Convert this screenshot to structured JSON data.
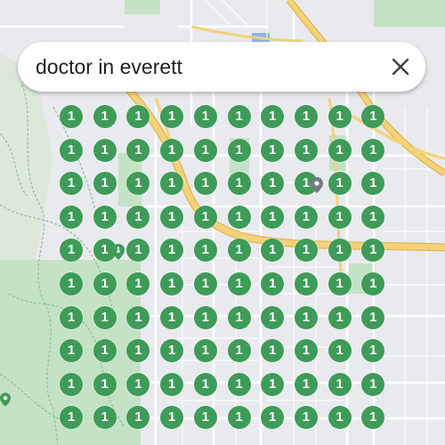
{
  "search": {
    "query": "doctor in everett",
    "close_icon": "close-icon"
  },
  "map": {
    "colors": {
      "land": "#e9eaee",
      "park": "#c4e2c5",
      "park_dark": "#b7dbb9",
      "highway": "#f3d27a",
      "highway_edge": "#e3b54b",
      "road": "#ffffff",
      "trail": "#8cc291",
      "water_blue": "#8ab4f8",
      "poi_grey": "#737a83"
    }
  },
  "grid": {
    "rows": 10,
    "cols": 10,
    "marker_color": "#3e9b58",
    "text_color": "#ffffff",
    "ranks": [
      [
        "1",
        "1",
        "1",
        "1",
        "1",
        "1",
        "1",
        "1",
        "1",
        "1"
      ],
      [
        "1",
        "1",
        "1",
        "1",
        "1",
        "1",
        "1",
        "1",
        "1",
        "1"
      ],
      [
        "1",
        "1",
        "1",
        "1",
        "1",
        "1",
        "1",
        "1",
        "1",
        "1"
      ],
      [
        "1",
        "1",
        "1",
        "1",
        "1",
        "1",
        "1",
        "1",
        "1",
        "1"
      ],
      [
        "1",
        "1",
        "1",
        "1",
        "1",
        "1",
        "1",
        "1",
        "1",
        "1"
      ],
      [
        "1",
        "1",
        "1",
        "1",
        "1",
        "1",
        "1",
        "1",
        "1",
        "1"
      ],
      [
        "1",
        "1",
        "1",
        "1",
        "1",
        "1",
        "1",
        "1",
        "1",
        "1"
      ],
      [
        "1",
        "1",
        "1",
        "1",
        "1",
        "1",
        "1",
        "1",
        "1",
        "1"
      ],
      [
        "1",
        "1",
        "1",
        "1",
        "1",
        "1",
        "1",
        "1",
        "1",
        "1"
      ],
      [
        "1",
        "1",
        "1",
        "1",
        "1",
        "1",
        "1",
        "1",
        "1",
        "1"
      ]
    ]
  },
  "pois": [
    {
      "name": "medical-pin-icon",
      "color": "#737a83"
    },
    {
      "name": "hiking-trail-icon",
      "color": "#3e9b58"
    },
    {
      "name": "park-pin-icon",
      "color": "#3e9b58"
    }
  ]
}
